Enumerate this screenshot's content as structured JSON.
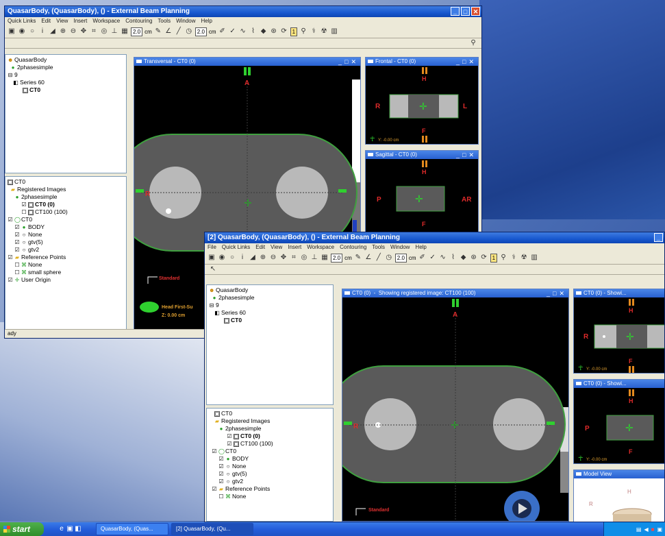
{
  "colors": {
    "titlebar": "#1858cf",
    "body_contour": "#5a5a5a",
    "contour_edge": "#3fa03f",
    "sphere": "#b9b9b9",
    "marker_green": "#2fd02f",
    "marker_orange": "#e38a1e",
    "marker_red": "#e02a2a"
  },
  "back_window": {
    "title": "QuasarBody, (QuasarBody), () - External Beam Planning",
    "menu": [
      "Quick Links",
      "Edit",
      "View",
      "Insert",
      "Workspace",
      "Contouring",
      "Tools",
      "Window",
      "Help"
    ],
    "toolbar": {
      "value1": "2.0",
      "unit1": "cm",
      "value2": "2.0",
      "unit2": "cm",
      "value3": "1"
    },
    "tree_top": [
      "QuasarBody",
      "2phasesimple",
      "9",
      "Series 60",
      "CT0"
    ],
    "tree_bottom": [
      "CT0",
      "Registered Images",
      "2phasesimple",
      "CT0 (0)",
      "CT100 (100)",
      "CT0",
      "BODY",
      "None",
      "gtv(5)",
      "gtv2",
      "Reference Points",
      "None",
      "small sphere",
      "User Origin"
    ],
    "views": {
      "transversal": {
        "title": "Transversal - CT0 (0)",
        "top_label": "A",
        "left_label": "R",
        "standard": "Standard",
        "orientation": "Head First-Su",
        "z_label": "Z: 0.00 cm"
      },
      "frontal": {
        "title": "Frontal - CT0 (0)",
        "h": "H",
        "r": "R",
        "l": "L",
        "f": "F",
        "y_label": "Y: -0.00 cm"
      },
      "sagittal": {
        "title": "Sagittal - CT0 (0)",
        "h": "H",
        "p": "P",
        "a": "AR",
        "f": "F"
      }
    },
    "status": "ady"
  },
  "front_window": {
    "title": "[2] QuasarBody, (QuasarBody), () - External Beam Planning",
    "menu": [
      "File",
      "Quick Links",
      "Edit",
      "View",
      "Insert",
      "Workspace",
      "Contouring",
      "Tools",
      "Window",
      "Help"
    ],
    "toolbar": {
      "value1": "2.0",
      "unit1": "cm",
      "value2": "2.0",
      "unit2": "cm",
      "value3": "1"
    },
    "tree_top": [
      "QuasarBody",
      "2phasesimple",
      "9",
      "Series 60",
      "CT0"
    ],
    "tree_bottom": [
      "CT0",
      "Registered Images",
      "2phasesimple",
      "CT0 (0)",
      "CT100 (100)",
      "CT0",
      "BODY",
      "None",
      "gtv(5)",
      "gtv2",
      "Reference Points",
      "None"
    ],
    "views": {
      "main": {
        "title": "CT0 (0)",
        "registered": "Showing registered image: CT100 (100)",
        "top_label": "A",
        "left_label": "R",
        "standard": "Standard"
      },
      "frontal": {
        "title": "CT0 (0) - Showi...",
        "h": "H",
        "r": "R",
        "f": "F",
        "y_label": "Y: -0.00 cm"
      },
      "sagittal": {
        "title": "CT0 (0) - Showi...",
        "h": "H",
        "p": "P",
        "f": "F",
        "y_label": "Y: -0.00 cm"
      },
      "model": {
        "title": "Model View",
        "h": "H",
        "r": "R"
      }
    }
  },
  "taskbar": {
    "start": "start",
    "tasks": [
      "QuasarBody, (Quas...",
      "[2] QuasarBody, (Qu..."
    ]
  }
}
